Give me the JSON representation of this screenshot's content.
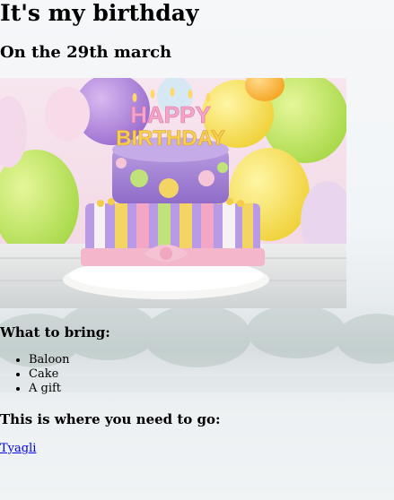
{
  "page": {
    "title": "It's my birthday",
    "date_heading": "On the 29th march",
    "cake_topper": {
      "line1": "HAPPY",
      "line2": "BIRTHDAY"
    },
    "bring_heading": "What to bring:",
    "bring_items": [
      "Baloon",
      "Cake",
      "A gift"
    ],
    "location_heading": "This is where you need to go:",
    "location_link": "Tyagli"
  },
  "colors": {
    "link": "#0000ee",
    "text": "#000000"
  }
}
